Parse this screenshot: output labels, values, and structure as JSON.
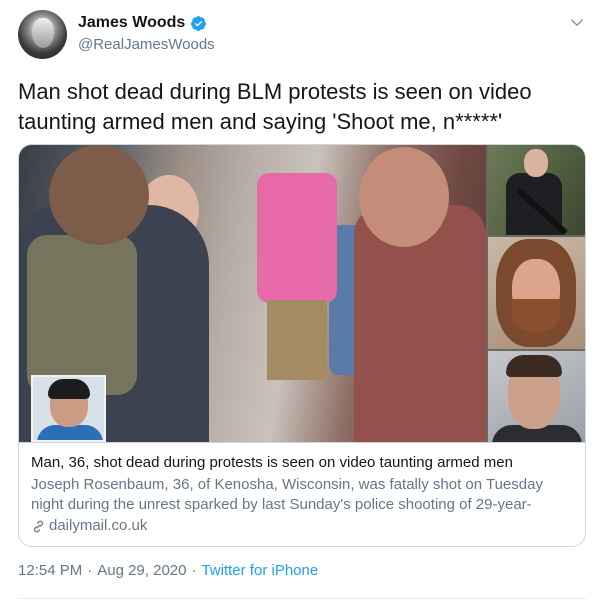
{
  "user": {
    "display_name": "James Woods",
    "handle": "@RealJamesWoods",
    "verified": true
  },
  "tweet": {
    "text": "Man shot dead during BLM protests is seen on video taunting armed men and saying 'Shoot me, n*****'"
  },
  "card": {
    "title": "Man, 36, shot dead during protests is seen on video taunting armed men",
    "description": "Joseph Rosenbaum, 36, of Kenosha, Wisconsin, was fatally shot on Tuesday night during the unrest sparked by last Sunday's police shooting of 29-year-",
    "domain": "dailymail.co.uk"
  },
  "meta": {
    "time": "12:54 PM",
    "separator_1": "·",
    "date": "Aug 29, 2020",
    "separator_2": "·",
    "source": "Twitter for iPhone"
  },
  "colors": {
    "accent": "#1da1f2",
    "secondary_text": "#657786",
    "border": "#ccd6dd"
  },
  "icons": {
    "verified": "verified-badge-icon",
    "menu": "chevron-down-icon",
    "link": "link-icon"
  }
}
